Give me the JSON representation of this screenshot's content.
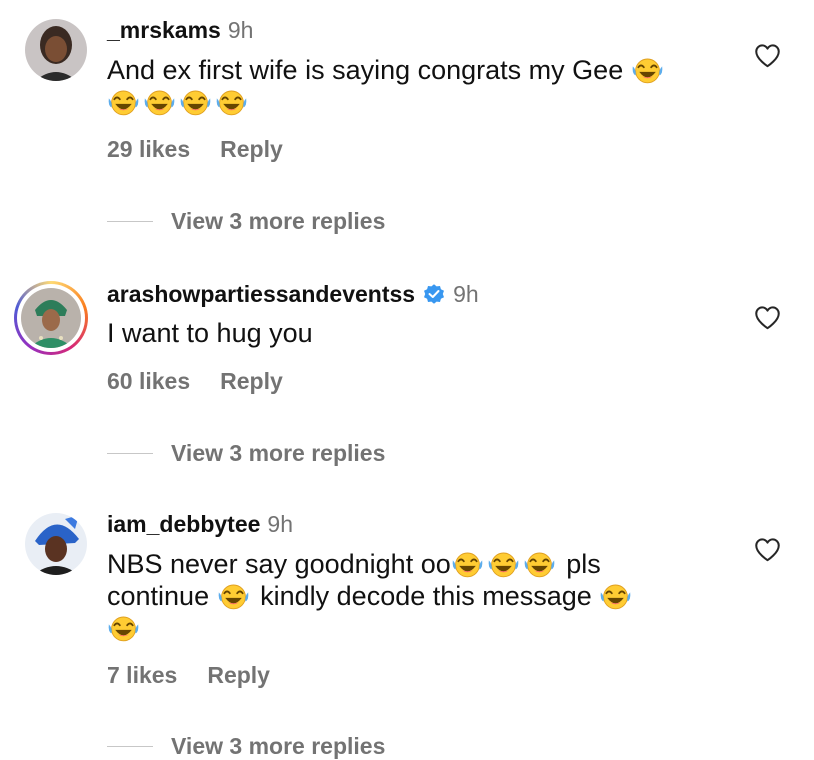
{
  "comments": [
    {
      "username": "_mrskams",
      "time": "9h",
      "verified": false,
      "text_line1": "And ex first wife is saying congrats my Gee",
      "likes": "29 likes",
      "reply": "Reply",
      "view_replies": "View 3 more replies"
    },
    {
      "username": "arashowpartiessandeventss",
      "time": "9h",
      "verified": true,
      "text_line1": "I want to hug you",
      "likes": "60 likes",
      "reply": "Reply",
      "view_replies": "View 3 more replies"
    },
    {
      "username": "iam_debbytee",
      "time": "9h",
      "verified": false,
      "text_line1": "NBS never say goodnight oo",
      "text_line1_end": "pls",
      "text_line2_start": "continue",
      "text_line2_end": "kindly decode this message",
      "likes": "7 likes",
      "reply": "Reply",
      "view_replies": "View 3 more replies"
    }
  ],
  "emoji_name": "face-with-tears-of-joy",
  "colors": {
    "username": "#111111",
    "secondary": "#737373",
    "verified": "#3897f0",
    "divider": "#c7c7c7"
  }
}
